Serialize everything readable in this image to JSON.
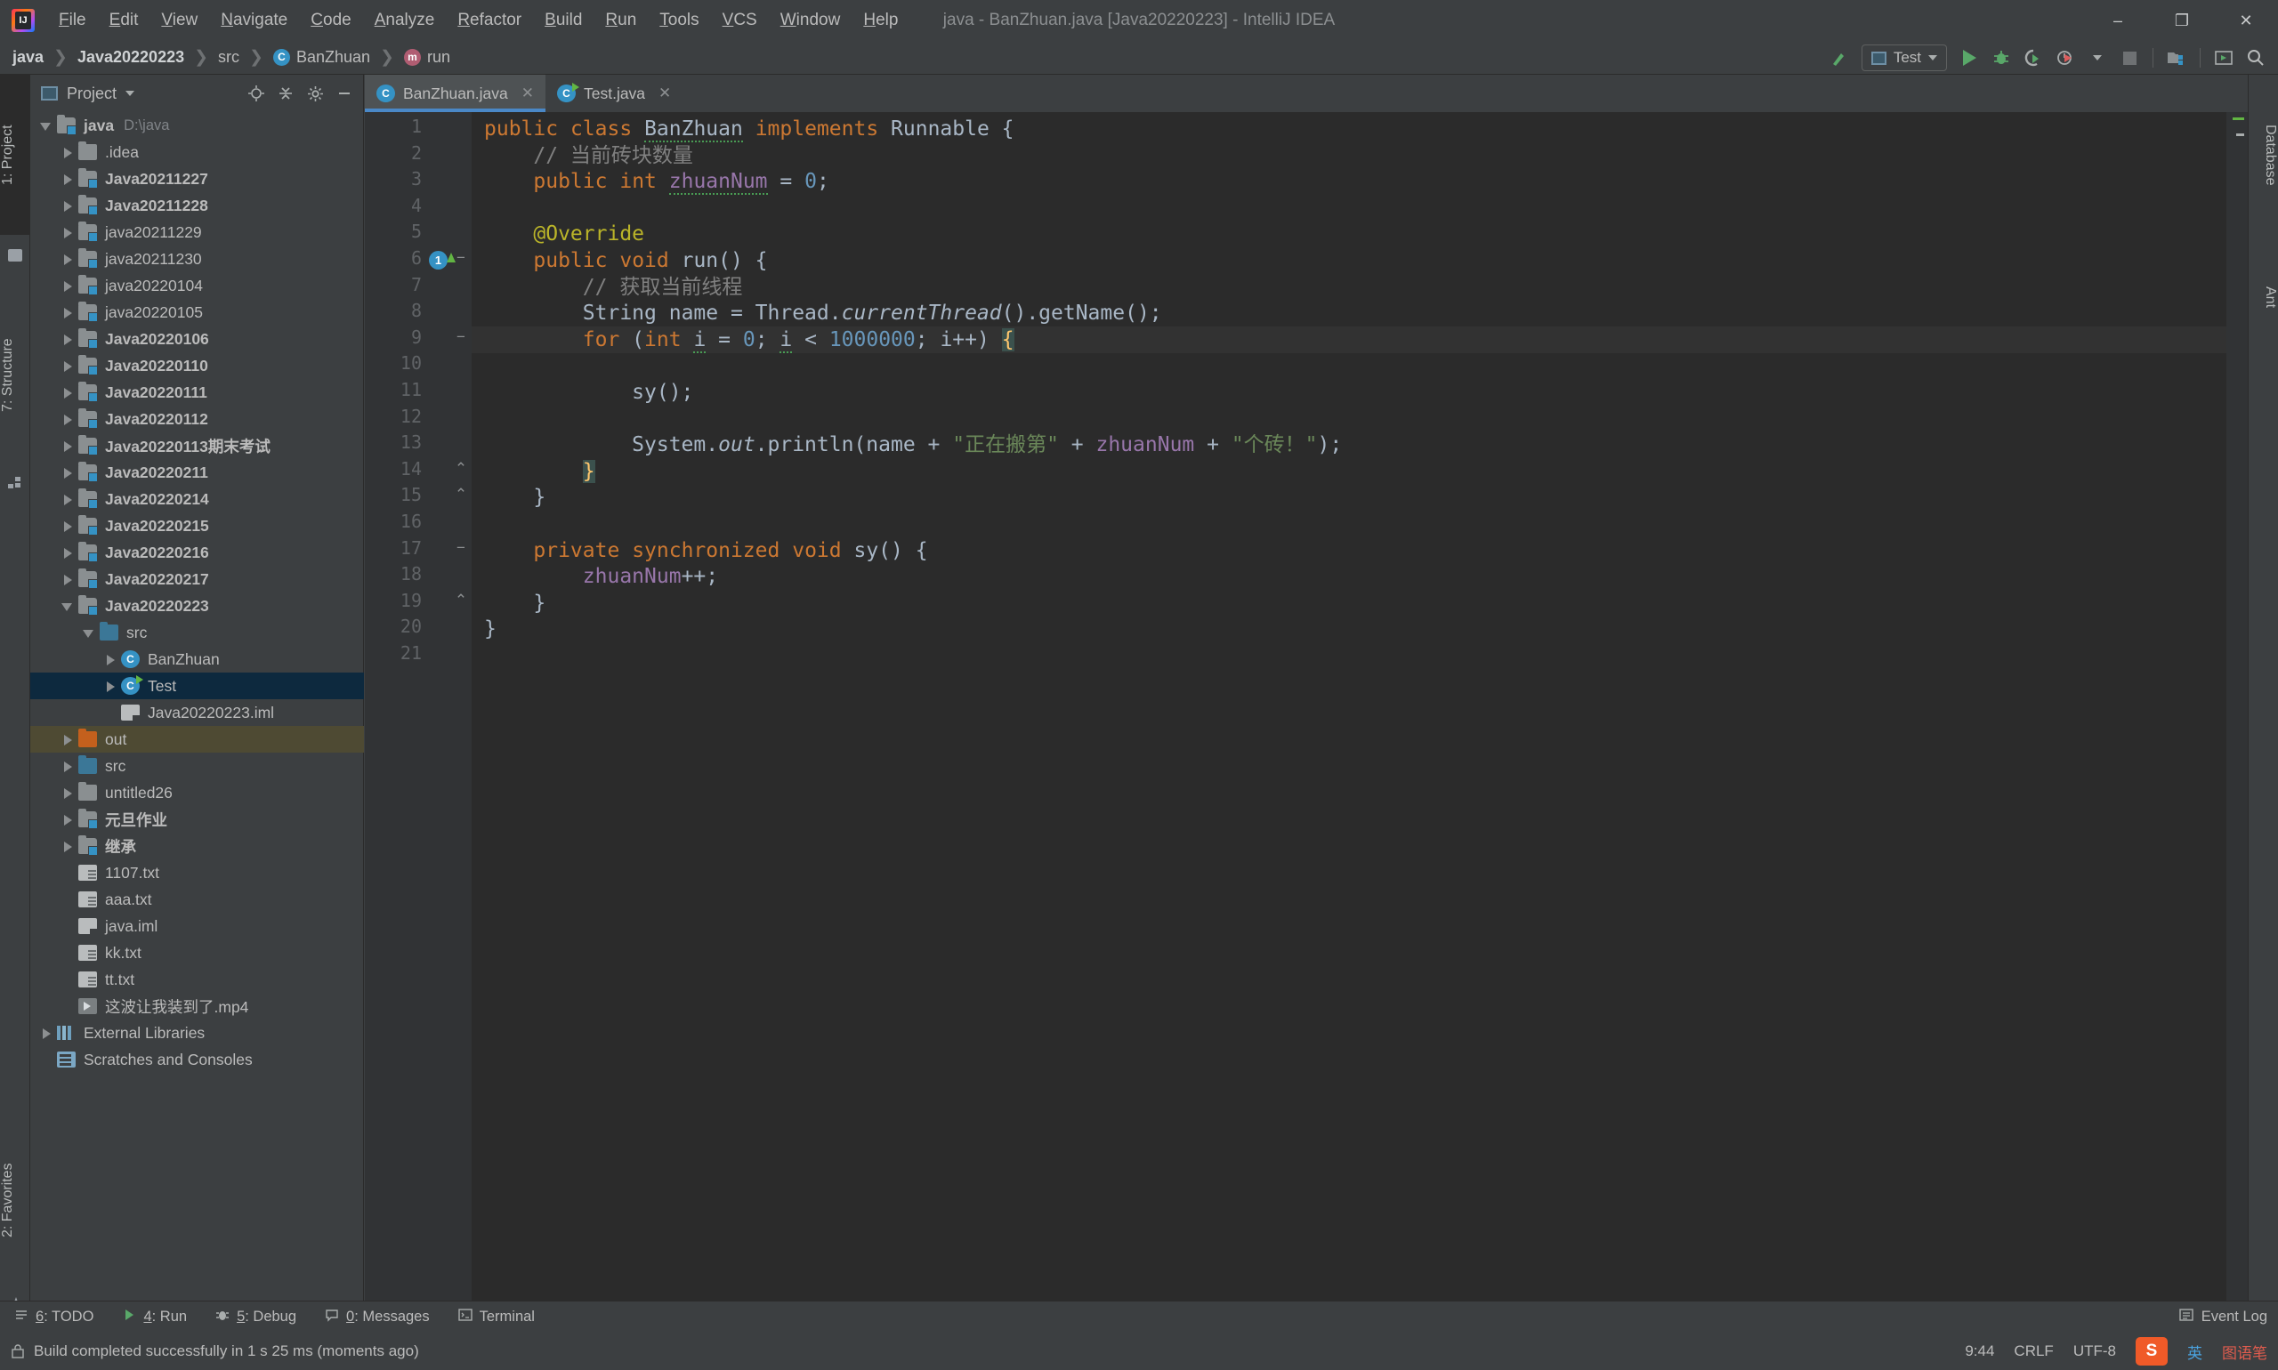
{
  "window": {
    "title": "java - BanZhuan.java [Java20220223] - IntelliJ IDEA",
    "minimize": "–",
    "maximize": "❐",
    "close": "✕"
  },
  "menu": [
    "File",
    "Edit",
    "View",
    "Navigate",
    "Code",
    "Analyze",
    "Refactor",
    "Build",
    "Run",
    "Tools",
    "VCS",
    "Window",
    "Help"
  ],
  "breadcrumb": [
    {
      "label": "java",
      "icon": "none",
      "bold": true
    },
    {
      "label": "Java20220223",
      "icon": "none",
      "bold": true
    },
    {
      "label": "src",
      "icon": "none",
      "bold": false
    },
    {
      "label": "BanZhuan",
      "icon": "class-icon",
      "glyph": "C",
      "bold": false
    },
    {
      "label": "run",
      "icon": "method-icon",
      "glyph": "m",
      "bold": false
    }
  ],
  "toolbar": {
    "run_config": "Test",
    "buttons": [
      "build-icon",
      "run-icon",
      "debug-icon",
      "run-coverage-icon",
      "profiler-icon",
      "stop-icon",
      "project-structure-icon",
      "updates-icon",
      "search-icon"
    ]
  },
  "left_stripe": [
    {
      "label": "1: Project",
      "active": true
    },
    {
      "label": "7: Structure",
      "active": false
    },
    {
      "label": "2: Favorites",
      "active": false
    }
  ],
  "right_stripe": [
    {
      "label": "Database"
    },
    {
      "label": "Ant"
    }
  ],
  "project_panel": {
    "title": "Project",
    "actions": [
      "locate-icon",
      "collapse-all-icon",
      "settings-icon",
      "hide-icon"
    ],
    "tree": [
      {
        "depth": 0,
        "arrow": "down",
        "icon": "module",
        "label": "java",
        "bold": true,
        "path": "D:\\java"
      },
      {
        "depth": 1,
        "arrow": "right",
        "icon": "folder",
        "label": ".idea",
        "bold": false
      },
      {
        "depth": 1,
        "arrow": "right",
        "icon": "module",
        "label": "Java20211227",
        "bold": true
      },
      {
        "depth": 1,
        "arrow": "right",
        "icon": "module",
        "label": "Java20211228",
        "bold": true
      },
      {
        "depth": 1,
        "arrow": "right",
        "icon": "module",
        "label": "java20211229",
        "bold": false
      },
      {
        "depth": 1,
        "arrow": "right",
        "icon": "module",
        "label": "java20211230",
        "bold": false
      },
      {
        "depth": 1,
        "arrow": "right",
        "icon": "module",
        "label": "java20220104",
        "bold": false
      },
      {
        "depth": 1,
        "arrow": "right",
        "icon": "module",
        "label": "java20220105",
        "bold": false
      },
      {
        "depth": 1,
        "arrow": "right",
        "icon": "module",
        "label": "Java20220106",
        "bold": true
      },
      {
        "depth": 1,
        "arrow": "right",
        "icon": "module",
        "label": "Java20220110",
        "bold": true
      },
      {
        "depth": 1,
        "arrow": "right",
        "icon": "module",
        "label": "Java20220111",
        "bold": true
      },
      {
        "depth": 1,
        "arrow": "right",
        "icon": "module",
        "label": "Java20220112",
        "bold": true
      },
      {
        "depth": 1,
        "arrow": "right",
        "icon": "module",
        "label": "Java20220113期末考试",
        "bold": true
      },
      {
        "depth": 1,
        "arrow": "right",
        "icon": "module",
        "label": "Java20220211",
        "bold": true
      },
      {
        "depth": 1,
        "arrow": "right",
        "icon": "module",
        "label": "Java20220214",
        "bold": true
      },
      {
        "depth": 1,
        "arrow": "right",
        "icon": "module",
        "label": "Java20220215",
        "bold": true
      },
      {
        "depth": 1,
        "arrow": "right",
        "icon": "module",
        "label": "Java20220216",
        "bold": true
      },
      {
        "depth": 1,
        "arrow": "right",
        "icon": "module",
        "label": "Java20220217",
        "bold": true
      },
      {
        "depth": 1,
        "arrow": "down",
        "icon": "module",
        "label": "Java20220223",
        "bold": true
      },
      {
        "depth": 2,
        "arrow": "down",
        "icon": "srcfolder",
        "label": "src",
        "bold": false
      },
      {
        "depth": 3,
        "arrow": "right",
        "icon": "class",
        "label": "BanZhuan",
        "bold": false
      },
      {
        "depth": 3,
        "arrow": "right",
        "icon": "classrun",
        "label": "Test",
        "bold": false,
        "state": "selected"
      },
      {
        "depth": 3,
        "arrow": "none",
        "icon": "iml",
        "label": "Java20220223.iml",
        "bold": false
      },
      {
        "depth": 1,
        "arrow": "right",
        "icon": "outfolder",
        "label": "out",
        "bold": false,
        "state": "highlight"
      },
      {
        "depth": 1,
        "arrow": "right",
        "icon": "srcfolder",
        "label": "src",
        "bold": false
      },
      {
        "depth": 1,
        "arrow": "right",
        "icon": "folder",
        "label": "untitled26",
        "bold": false
      },
      {
        "depth": 1,
        "arrow": "right",
        "icon": "module",
        "label": "元旦作业",
        "bold": true
      },
      {
        "depth": 1,
        "arrow": "right",
        "icon": "module",
        "label": "继承",
        "bold": true
      },
      {
        "depth": 1,
        "arrow": "none",
        "icon": "file",
        "label": "1107.txt",
        "bold": false
      },
      {
        "depth": 1,
        "arrow": "none",
        "icon": "file",
        "label": "aaa.txt",
        "bold": false
      },
      {
        "depth": 1,
        "arrow": "none",
        "icon": "iml",
        "label": "java.iml",
        "bold": false
      },
      {
        "depth": 1,
        "arrow": "none",
        "icon": "file",
        "label": "kk.txt",
        "bold": false
      },
      {
        "depth": 1,
        "arrow": "none",
        "icon": "file",
        "label": "tt.txt",
        "bold": false
      },
      {
        "depth": 1,
        "arrow": "none",
        "icon": "mp4",
        "label": "这波让我装到了.mp4",
        "bold": false
      },
      {
        "depth": 0,
        "arrow": "right",
        "icon": "lib",
        "label": "External Libraries",
        "bold": false
      },
      {
        "depth": 0,
        "arrow": "none",
        "icon": "scratch",
        "label": "Scratches and Consoles",
        "bold": false
      }
    ]
  },
  "editor": {
    "tabs": [
      {
        "label": "BanZhuan.java",
        "icon": "class-icon",
        "glyph": "C",
        "active": true,
        "close": "✕"
      },
      {
        "label": "Test.java",
        "icon": "class-run-icon",
        "glyph": "C",
        "active": false,
        "close": "✕"
      }
    ],
    "line_numbers": [
      "1",
      "2",
      "3",
      "4",
      "5",
      "6",
      "7",
      "8",
      "9",
      "10",
      "11",
      "12",
      "13",
      "14",
      "15",
      "16",
      "17",
      "18",
      "19",
      "20",
      "21"
    ],
    "gutter_run_line": 6,
    "gutter_run_badge": "1",
    "caret_line": 9,
    "lines": [
      {
        "n": 1,
        "tokens": [
          {
            "t": "public",
            "c": "kw"
          },
          {
            "t": " ",
            "c": "id"
          },
          {
            "t": "class",
            "c": "kw"
          },
          {
            "t": " ",
            "c": "id"
          },
          {
            "t": "BanZhuan",
            "c": "cls2 wavy"
          },
          {
            "t": " ",
            "c": "id"
          },
          {
            "t": "implements",
            "c": "kw"
          },
          {
            "t": " ",
            "c": "id"
          },
          {
            "t": "Runnable",
            "c": "cls2"
          },
          {
            "t": " {",
            "c": "id"
          }
        ]
      },
      {
        "n": 2,
        "tokens": [
          {
            "t": "    // 当前砖块数量",
            "c": "cmt"
          }
        ]
      },
      {
        "n": 3,
        "tokens": [
          {
            "t": "    ",
            "c": "id"
          },
          {
            "t": "public",
            "c": "kw"
          },
          {
            "t": " ",
            "c": "id"
          },
          {
            "t": "int",
            "c": "kw"
          },
          {
            "t": " ",
            "c": "id"
          },
          {
            "t": "zhuanNum",
            "c": "fld wavy"
          },
          {
            "t": " = ",
            "c": "id"
          },
          {
            "t": "0",
            "c": "num"
          },
          {
            "t": ";",
            "c": "id"
          }
        ]
      },
      {
        "n": 4,
        "tokens": []
      },
      {
        "n": 5,
        "tokens": [
          {
            "t": "    ",
            "c": "id"
          },
          {
            "t": "@Override",
            "c": "ann"
          }
        ]
      },
      {
        "n": 6,
        "tokens": [
          {
            "t": "    ",
            "c": "id"
          },
          {
            "t": "public",
            "c": "kw"
          },
          {
            "t": " ",
            "c": "id"
          },
          {
            "t": "void",
            "c": "kw"
          },
          {
            "t": " ",
            "c": "id"
          },
          {
            "t": "run",
            "c": "cls2"
          },
          {
            "t": "() {",
            "c": "id"
          }
        ]
      },
      {
        "n": 7,
        "tokens": [
          {
            "t": "        // 获取当前线程",
            "c": "cmt"
          }
        ]
      },
      {
        "n": 8,
        "tokens": [
          {
            "t": "        ",
            "c": "id"
          },
          {
            "t": "String",
            "c": "cls2"
          },
          {
            "t": " name = ",
            "c": "id"
          },
          {
            "t": "Thread",
            "c": "cls2"
          },
          {
            "t": ".",
            "c": "id"
          },
          {
            "t": "currentThread",
            "c": "sfld"
          },
          {
            "t": "().getName();",
            "c": "id"
          }
        ]
      },
      {
        "n": 9,
        "tokens": [
          {
            "t": "        ",
            "c": "id"
          },
          {
            "t": "for",
            "c": "kw"
          },
          {
            "t": " (",
            "c": "id"
          },
          {
            "t": "int",
            "c": "kw"
          },
          {
            "t": " ",
            "c": "id"
          },
          {
            "t": "i",
            "c": "id wavy"
          },
          {
            "t": " = ",
            "c": "id"
          },
          {
            "t": "0",
            "c": "num"
          },
          {
            "t": "; ",
            "c": "id"
          },
          {
            "t": "i",
            "c": "id wavy"
          },
          {
            "t": " < ",
            "c": "id"
          },
          {
            "t": "1000000",
            "c": "num"
          },
          {
            "t": "; i++) ",
            "c": "id"
          },
          {
            "t": "{",
            "c": "brace-hl"
          }
        ]
      },
      {
        "n": 10,
        "tokens": []
      },
      {
        "n": 11,
        "tokens": [
          {
            "t": "            sy();",
            "c": "id"
          }
        ]
      },
      {
        "n": 12,
        "tokens": []
      },
      {
        "n": 13,
        "tokens": [
          {
            "t": "            ",
            "c": "id"
          },
          {
            "t": "System",
            "c": "cls2"
          },
          {
            "t": ".",
            "c": "id"
          },
          {
            "t": "out",
            "c": "sfld"
          },
          {
            "t": ".println(name + ",
            "c": "id"
          },
          {
            "t": "\"正在搬第\"",
            "c": "str"
          },
          {
            "t": " + ",
            "c": "id"
          },
          {
            "t": "zhuanNum",
            "c": "fld"
          },
          {
            "t": " + ",
            "c": "id"
          },
          {
            "t": "\"个砖！\"",
            "c": "str"
          },
          {
            "t": ");",
            "c": "id"
          }
        ]
      },
      {
        "n": 14,
        "tokens": [
          {
            "t": "        ",
            "c": "id"
          },
          {
            "t": "}",
            "c": "brace-hl"
          }
        ]
      },
      {
        "n": 15,
        "tokens": [
          {
            "t": "    }",
            "c": "id"
          }
        ]
      },
      {
        "n": 16,
        "tokens": []
      },
      {
        "n": 17,
        "tokens": [
          {
            "t": "    ",
            "c": "id"
          },
          {
            "t": "private",
            "c": "kw"
          },
          {
            "t": " ",
            "c": "id"
          },
          {
            "t": "synchronized",
            "c": "kw"
          },
          {
            "t": " ",
            "c": "id"
          },
          {
            "t": "void",
            "c": "kw"
          },
          {
            "t": " ",
            "c": "id"
          },
          {
            "t": "sy",
            "c": "cls2"
          },
          {
            "t": "() {",
            "c": "id"
          }
        ]
      },
      {
        "n": 18,
        "tokens": [
          {
            "t": "        ",
            "c": "id"
          },
          {
            "t": "zhuanNum",
            "c": "fld"
          },
          {
            "t": "++;",
            "c": "id"
          }
        ]
      },
      {
        "n": 19,
        "tokens": [
          {
            "t": "    }",
            "c": "id"
          }
        ]
      },
      {
        "n": 20,
        "tokens": [
          {
            "t": "}",
            "c": "id"
          }
        ]
      },
      {
        "n": 21,
        "tokens": []
      }
    ]
  },
  "bottom_bar": {
    "items": [
      {
        "label": "6: TODO",
        "icon": "todo-icon"
      },
      {
        "label": "4: Run",
        "icon": "run-icon"
      },
      {
        "label": "5: Debug",
        "icon": "debug-icon"
      },
      {
        "label": "0: Messages",
        "icon": "messages-icon"
      },
      {
        "label": "Terminal",
        "icon": "terminal-icon"
      }
    ],
    "event_log": "Event Log"
  },
  "status_bar": {
    "message": "Build completed successfully in 1 s 25 ms (moments ago)",
    "caret_position": "9:44",
    "line_separator": "CRLF",
    "encoding": "UTF-8",
    "ime_sogou": "S",
    "ime_lang": "英",
    "ime_extra": "图语笔"
  }
}
